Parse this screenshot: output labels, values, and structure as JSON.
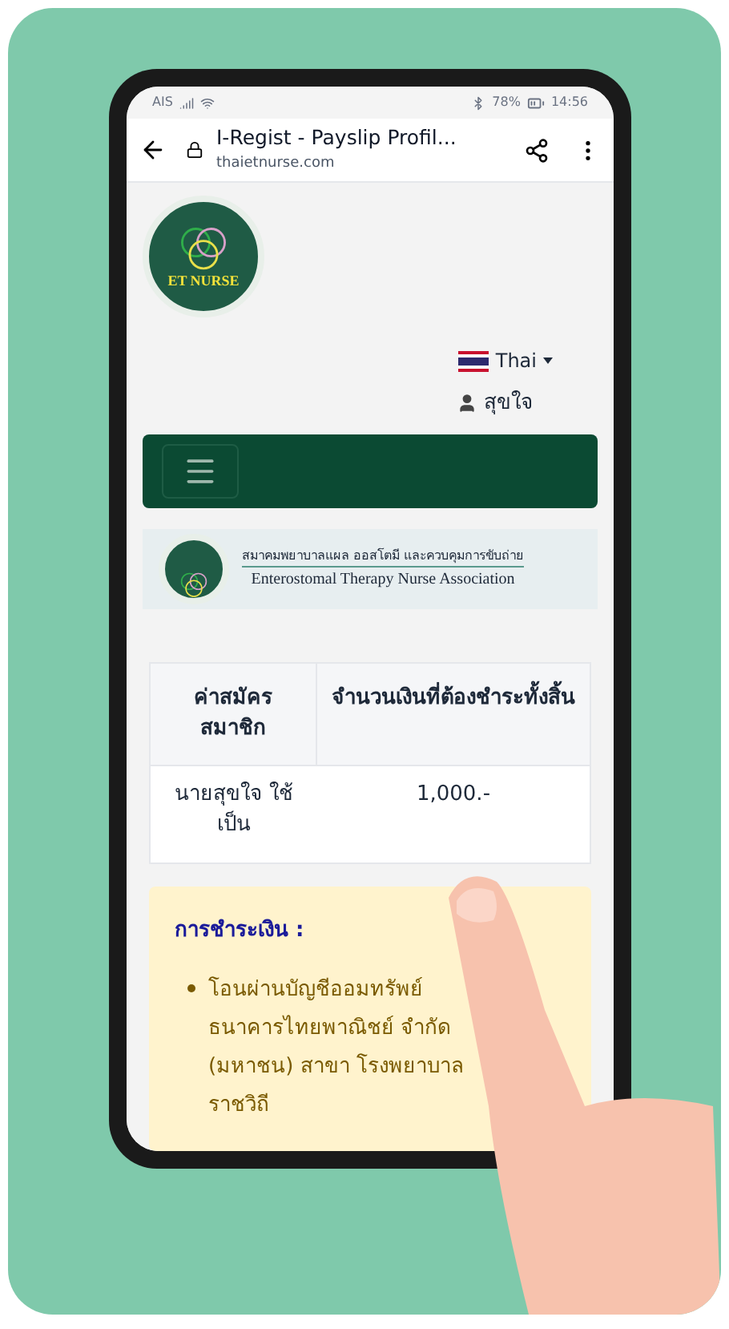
{
  "status_bar": {
    "carrier": "AIS",
    "battery": "78%",
    "time": "14:56"
  },
  "browser": {
    "title": "I-Regist - Payslip Profil...",
    "url": "thaietnurse.com"
  },
  "logo": {
    "text": "ET NURSE"
  },
  "language": {
    "label": "Thai"
  },
  "user": {
    "name": "สุขใจ"
  },
  "banner": {
    "thai": "สมาคมพยาบาลแผล ออสโตมี และควบคุมการขับถ่าย",
    "english": "Enterostomal Therapy Nurse Association"
  },
  "table": {
    "columns": [
      "ค่าสมัคร สมาชิก",
      "จำนวนเงินที่ต้องชำระทั้งสิ้น"
    ],
    "rows": [
      [
        "นายสุขใจ ใช้เป็น",
        "1,000.-"
      ]
    ]
  },
  "payment": {
    "title": "การชำระเงิน :",
    "items": [
      "โอนผ่านบัญชีออมทรัพย์ ธนาคารไทยพาณิชย์ จำกัด (มหาชน) สาขา โรงพยาบาลราชวิถี"
    ]
  }
}
